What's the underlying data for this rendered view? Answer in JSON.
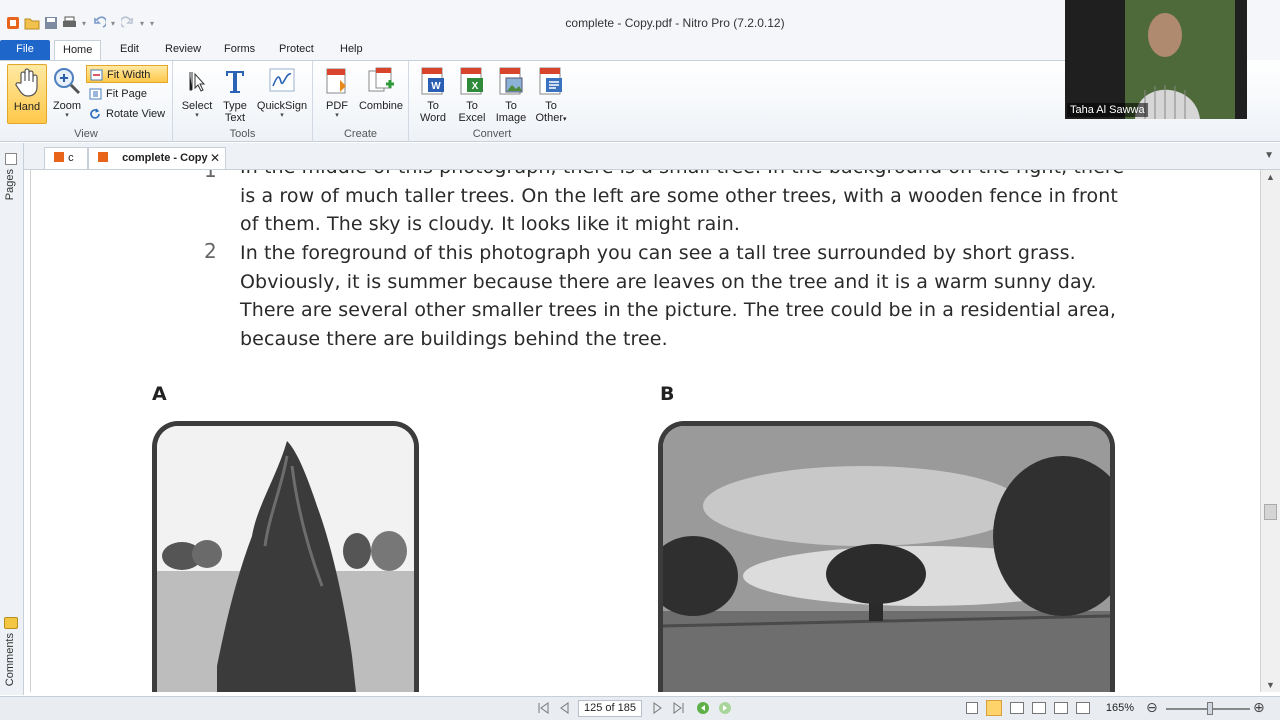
{
  "window": {
    "title": "complete - Copy.pdf - Nitro Pro (7.2.0.12)"
  },
  "menu": {
    "tabs": [
      {
        "label": "File"
      },
      {
        "label": "Home"
      },
      {
        "label": "Edit"
      },
      {
        "label": "Review"
      },
      {
        "label": "Forms"
      },
      {
        "label": "Protect"
      },
      {
        "label": "Help"
      }
    ]
  },
  "ribbon": {
    "view": {
      "group_label": "View",
      "hand": "Hand",
      "zoom": "Zoom",
      "fit_width": "Fit Width",
      "fit_page": "Fit Page",
      "rotate_view": "Rotate View"
    },
    "tools": {
      "group_label": "Tools",
      "select": "Select",
      "type_text_1": "Type",
      "type_text_2": "Text",
      "quicksign": "QuickSign"
    },
    "create": {
      "group_label": "Create",
      "pdf": "PDF",
      "combine": "Combine"
    },
    "convert": {
      "group_label": "Convert",
      "to_word_1": "To",
      "to_word_2": "Word",
      "to_excel_1": "To",
      "to_excel_2": "Excel",
      "to_image_1": "To",
      "to_image_2": "Image",
      "to_other_1": "To",
      "to_other_2": "Other"
    }
  },
  "doc_tabs": [
    {
      "label": "c"
    },
    {
      "label": "complete - Copy"
    }
  ],
  "side_panel": {
    "pages_label": "Pages",
    "comments_label": "Comments"
  },
  "document": {
    "para1_lines": [
      "In the middle of this photograph, there is a small tree. In the background on the right, there",
      "is a row of much taller trees. On the left are some other trees, with a wooden fence in front",
      "of them. The sky is cloudy. It looks like it might rain."
    ],
    "para1_number": "1",
    "para2_number": "2",
    "para2_lines": [
      "In the foreground of this photograph you can see a tall tree surrounded by short grass.",
      "Obviously, it is summer because there are leaves on the tree and it is a warm sunny day.",
      "There are several other smaller trees in the picture. The tree could be in a residential area,",
      "because there are buildings behind the tree."
    ],
    "image_a_label": "A",
    "image_b_label": "B"
  },
  "status": {
    "page_indicator": "125 of 185",
    "zoom": "165%"
  },
  "webcam": {
    "name": "Taha Al Sawwa"
  }
}
